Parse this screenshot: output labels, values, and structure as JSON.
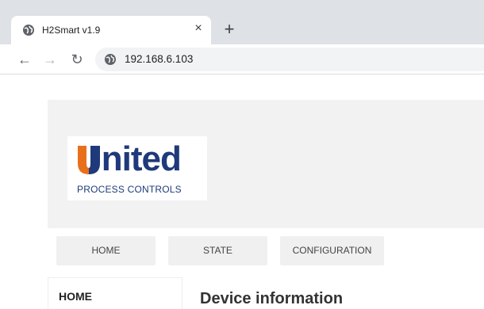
{
  "browser": {
    "tab": {
      "title": "H2Smart v1.9",
      "favicon": "globe-icon",
      "close": "×"
    },
    "new_tab": "+",
    "nav": {
      "back": "←",
      "forward": "→",
      "reload": "↻"
    },
    "url": "192.168.6.103",
    "site_icon": "globe-icon"
  },
  "header": {
    "logo": {
      "word": "United",
      "subtitle": "PROCESS CONTROLS",
      "colors": {
        "blue": "#1f3a7a",
        "orange": "#e8701a"
      }
    }
  },
  "menu": {
    "items": [
      {
        "label": "HOME"
      },
      {
        "label": "STATE"
      },
      {
        "label": "CONFIGURATION"
      }
    ]
  },
  "sidebar": {
    "heading": "HOME"
  },
  "main": {
    "title": "Device information"
  }
}
